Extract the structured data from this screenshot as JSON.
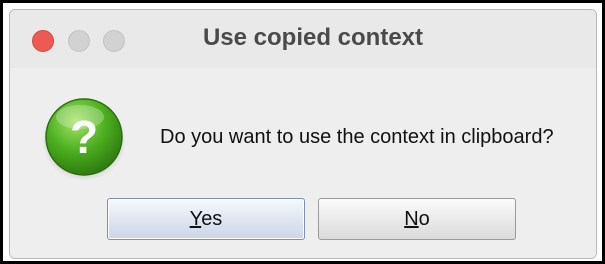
{
  "dialog": {
    "title": "Use copied context",
    "message": "Do you want to use the context in clipboard?",
    "icon": "question-icon",
    "buttons": {
      "yes_label": "Yes",
      "no_label": "No"
    }
  },
  "colors": {
    "close_button": "#ee5a52",
    "inactive_traffic": "#d2d2d2",
    "icon_green": "#4caf1f"
  }
}
